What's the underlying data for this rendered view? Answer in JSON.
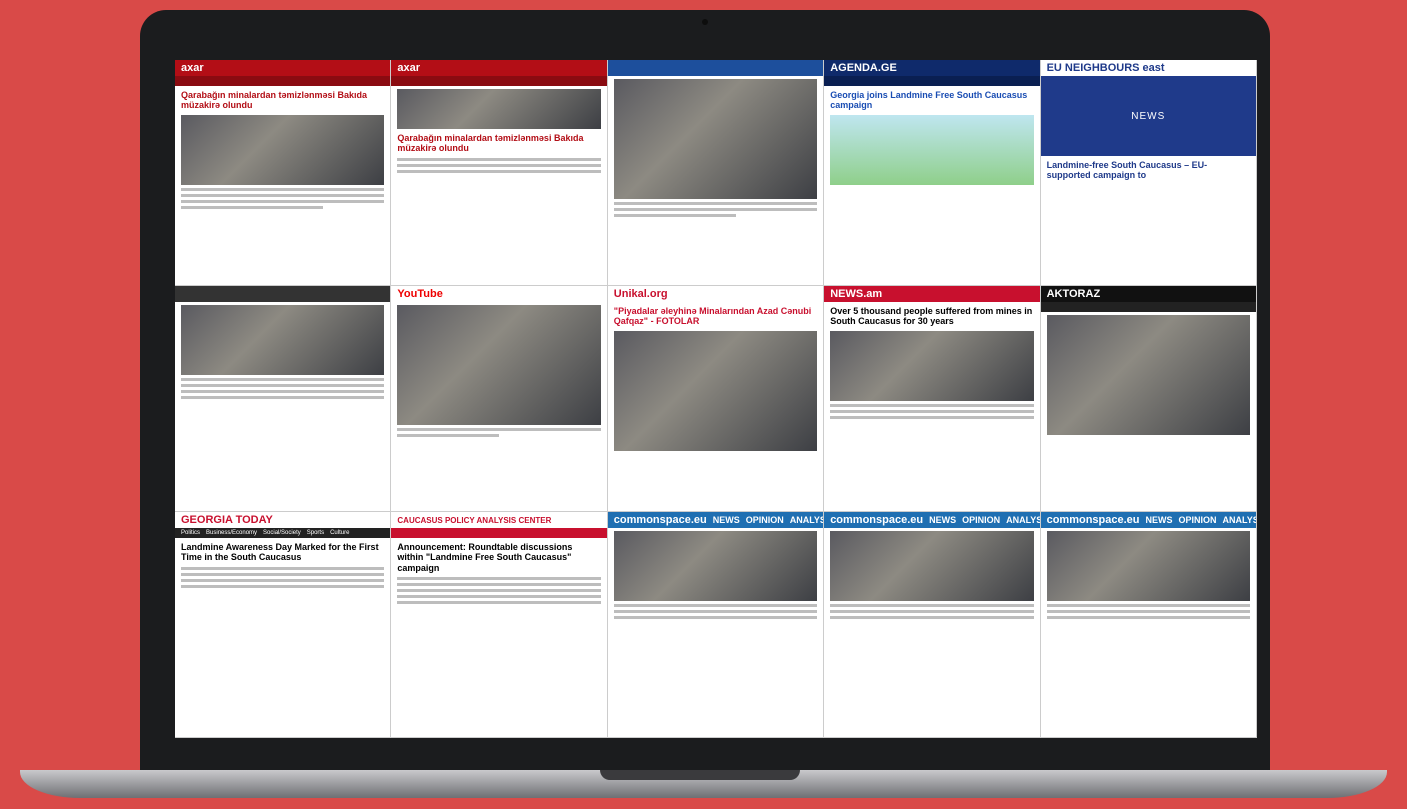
{
  "tiles": [
    {
      "logo": "axar",
      "headline": "Qarabağın minalardan təmizlənməsi Bakıda müzakirə olundu",
      "bar": "#b30e16"
    },
    {
      "logo": "axar",
      "headline": "Qarabağın minalardan təmizlənməsi Bakıda müzakirə olundu",
      "bar": "#b30e16"
    },
    {
      "logo": "",
      "headline": "",
      "bar": "#ffffff"
    },
    {
      "logo": "AGENDA.GE",
      "headline": "Georgia joins Landmine Free South Caucasus campaign",
      "bar": "#0f2a6b"
    },
    {
      "logo": "EU NEIGHBOURS east",
      "headline": "Landmine-free South Caucasus – EU-supported campaign to",
      "hero": "NEWS",
      "bar": "#ffffff"
    },
    {
      "logo": "",
      "headline": "",
      "bar": "#ffffff"
    },
    {
      "logo": "YouTube",
      "headline": "",
      "bar": "#ffffff"
    },
    {
      "logo": "Unikal.org",
      "headline": "\"Piyadalar əleyhinə Minalarından Azad Cənubi Qafqaz\" - FOTOLAR",
      "bar": "#ffffff"
    },
    {
      "logo": "NEWS.am",
      "headline": "Over 5 thousand people suffered from mines in South Caucasus for 30 years",
      "bar": "#c8102e"
    },
    {
      "logo": "AKTORAZ",
      "headline": "",
      "bar": "#111111"
    },
    {
      "logo": "GEORGIA TODAY",
      "headline": "Landmine Awareness Day Marked for the First Time in the South Caucasus",
      "bar": "#ffffff",
      "nav": [
        "Politics",
        "Business/Economy",
        "Social/Society",
        "Sports",
        "Culture"
      ]
    },
    {
      "logo": "CAUCASUS POLICY ANALYSIS CENTER",
      "headline": "Announcement: Roundtable discussions within \"Landmine Free South Caucasus\" campaign",
      "bar": "#ffffff"
    },
    {
      "logo": "commonspace.eu",
      "headline": "",
      "bar": "#1f6fb2",
      "nav": [
        "NEWS",
        "OPINION",
        "ANALYSIS"
      ]
    },
    {
      "logo": "commonspace.eu",
      "headline": "",
      "bar": "#1f6fb2",
      "nav": [
        "NEWS",
        "OPINION",
        "ANALYSIS"
      ]
    },
    {
      "logo": "commonspace.eu",
      "headline": "",
      "bar": "#1f6fb2",
      "nav": [
        "NEWS",
        "OPINION",
        "ANALYSIS"
      ]
    }
  ]
}
